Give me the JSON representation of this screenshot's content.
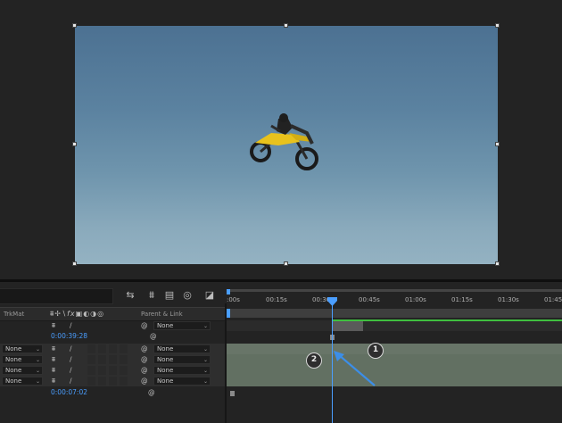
{
  "comp_panel": {
    "handles": 8
  },
  "timeline": {
    "ruler_labels": [
      ":00s",
      "00:15s",
      "00:30s",
      "00:45s",
      "01:00s",
      "01:15s",
      "01:30s",
      "01:45"
    ],
    "header": {
      "trkmat": "TrkMat",
      "parent_link": "Parent & Link"
    },
    "layers": [
      {
        "trkmat": "",
        "parent": "None",
        "time": "0:00:39:28"
      },
      {
        "trkmat": "None",
        "parent": "None",
        "time": ""
      },
      {
        "trkmat": "None",
        "parent": "None",
        "time": ""
      },
      {
        "trkmat": "None",
        "parent": "None",
        "time": ""
      },
      {
        "trkmat": "None",
        "parent": "None",
        "time": "0:00:07:02"
      }
    ]
  },
  "annotations": {
    "callout_1": "1",
    "callout_2": "2"
  },
  "colors": {
    "accent": "#4a9eff",
    "green_bar": "#3fbf3f",
    "sky_top": "#4c7192",
    "sky_bottom": "#94b2c2"
  }
}
